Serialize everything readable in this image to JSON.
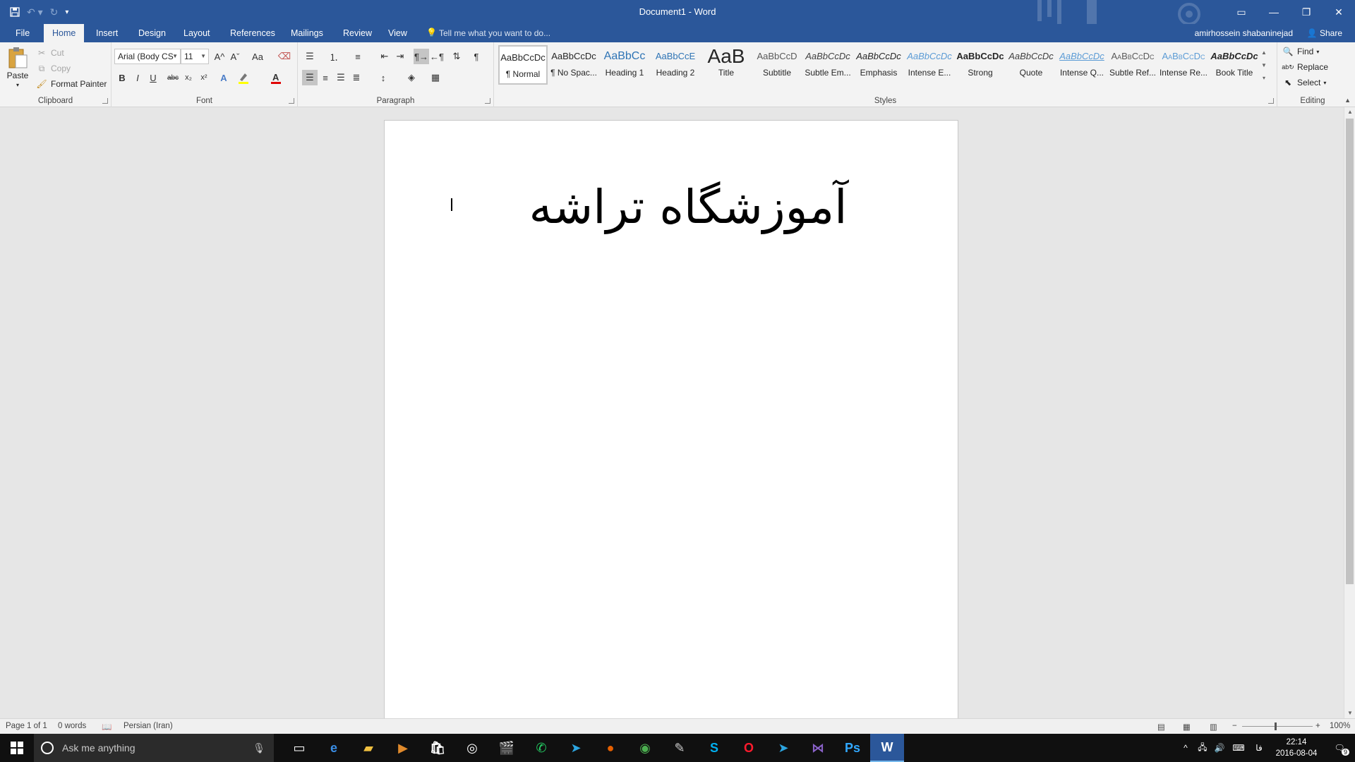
{
  "titlebar": {
    "title": "Document1 - Word",
    "qat": [
      "save-icon",
      "undo-icon",
      "redo-icon",
      "customize-qat-icon"
    ],
    "window_controls": [
      "ribbon-display-icon",
      "minimize-icon",
      "restore-icon",
      "close-icon"
    ]
  },
  "tabs": {
    "items": [
      "File",
      "Home",
      "Insert",
      "Design",
      "Layout",
      "References",
      "Mailings",
      "Review",
      "View"
    ],
    "active": "Home",
    "tell_me": "Tell me what you want to do...",
    "user": "amirhossein shabaninejad",
    "share": "Share"
  },
  "ribbon": {
    "clipboard": {
      "label": "Clipboard",
      "paste": "Paste",
      "cut": "Cut",
      "copy": "Copy",
      "format_painter": "Format Painter"
    },
    "font": {
      "label": "Font",
      "font_name": "Arial (Body CS",
      "font_size": "11",
      "bold": "B",
      "italic": "I",
      "underline": "U",
      "strikethrough": "abc",
      "subscript": "x₂",
      "superscript": "x²",
      "change_case": "Aa",
      "grow": "A^",
      "shrink": "Aˇ"
    },
    "paragraph": {
      "label": "Paragraph",
      "show_marks": "¶"
    },
    "styles": {
      "label": "Styles",
      "items": [
        {
          "preview": "AaBbCcDc",
          "name": "¶ Normal"
        },
        {
          "preview": "AaBbCcDc",
          "name": "¶ No Spac..."
        },
        {
          "preview": "AaBbCc",
          "name": "Heading 1"
        },
        {
          "preview": "AaBbCcE",
          "name": "Heading 2"
        },
        {
          "preview": "AaB",
          "name": "Title"
        },
        {
          "preview": "AaBbCcD",
          "name": "Subtitle"
        },
        {
          "preview": "AaBbCcDc",
          "name": "Subtle Em..."
        },
        {
          "preview": "AaBbCcDc",
          "name": "Emphasis"
        },
        {
          "preview": "AaBbCcDc",
          "name": "Intense E..."
        },
        {
          "preview": "AaBbCcDc",
          "name": "Strong"
        },
        {
          "preview": "AaBbCcDc",
          "name": "Quote"
        },
        {
          "preview": "AaBbCcDc",
          "name": "Intense Q..."
        },
        {
          "preview": "AaBbCcDc",
          "name": "Subtle Ref..."
        },
        {
          "preview": "AaBbCcDc",
          "name": "Intense Re..."
        },
        {
          "preview": "AaBbCcDc",
          "name": "Book Title"
        }
      ]
    },
    "editing": {
      "label": "Editing",
      "find": "Find",
      "replace": "Replace",
      "select": "Select"
    }
  },
  "document": {
    "text": "آموزشگاه تراشه"
  },
  "statusbar": {
    "page": "Page 1 of 1",
    "words": "0 words",
    "language": "Persian (Iran)",
    "zoom": "100%"
  },
  "taskbar": {
    "search_placeholder": "Ask me anything",
    "apps": [
      "task-view-icon",
      "edge-icon",
      "file-explorer-icon",
      "media-player-icon",
      "store-icon",
      "groove-icon",
      "movies-icon",
      "whatsapp-icon",
      "telegram-icon",
      "firefox-icon",
      "chrome-icon",
      "paint-icon",
      "skype-icon",
      "opera-icon",
      "telegram-desktop-icon",
      "visual-studio-icon",
      "photoshop-icon",
      "word-icon"
    ],
    "time": "22:14",
    "date": "2016-08-04",
    "lang": "فا",
    "notifications": "9"
  },
  "colors": {
    "word_blue": "#2b579a",
    "ribbon_bg": "#f3f3f3",
    "taskbar_bg": "#101010"
  }
}
